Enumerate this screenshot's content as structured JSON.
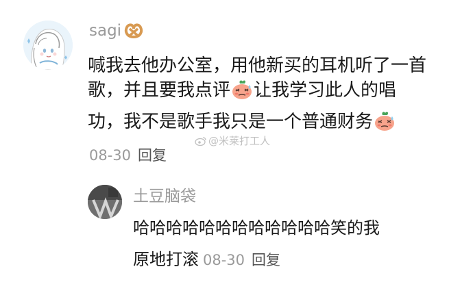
{
  "comment": {
    "username": "sagi",
    "username_badge_icon": "pretzel-icon",
    "lines": [
      "喊我去他办公室，用他新买的耳机听了一首",
      "歌，并且要我点评",
      "让我学习此人的唱",
      "功，我不是歌手我只是一个普通财务"
    ],
    "emoji_name": "shy-sweat-emoji-icon",
    "timestamp": "08-30",
    "reply_label": "回复"
  },
  "watermark": {
    "text": "@米莱打工人"
  },
  "reply": {
    "username": "土豆脑袋",
    "lines": [
      "哈哈哈哈哈哈哈哈哈哈哈哈笑的我",
      "原地打滚"
    ],
    "timestamp": "08-30",
    "reply_label": "回复"
  },
  "colors": {
    "username": "#9a9a9a",
    "text": "#1a1a1a",
    "meta": "#9a9a9a",
    "emoji_face": "#f7a48c",
    "emoji_leaf": "#49a55a",
    "pretzel": "#d89a52"
  }
}
